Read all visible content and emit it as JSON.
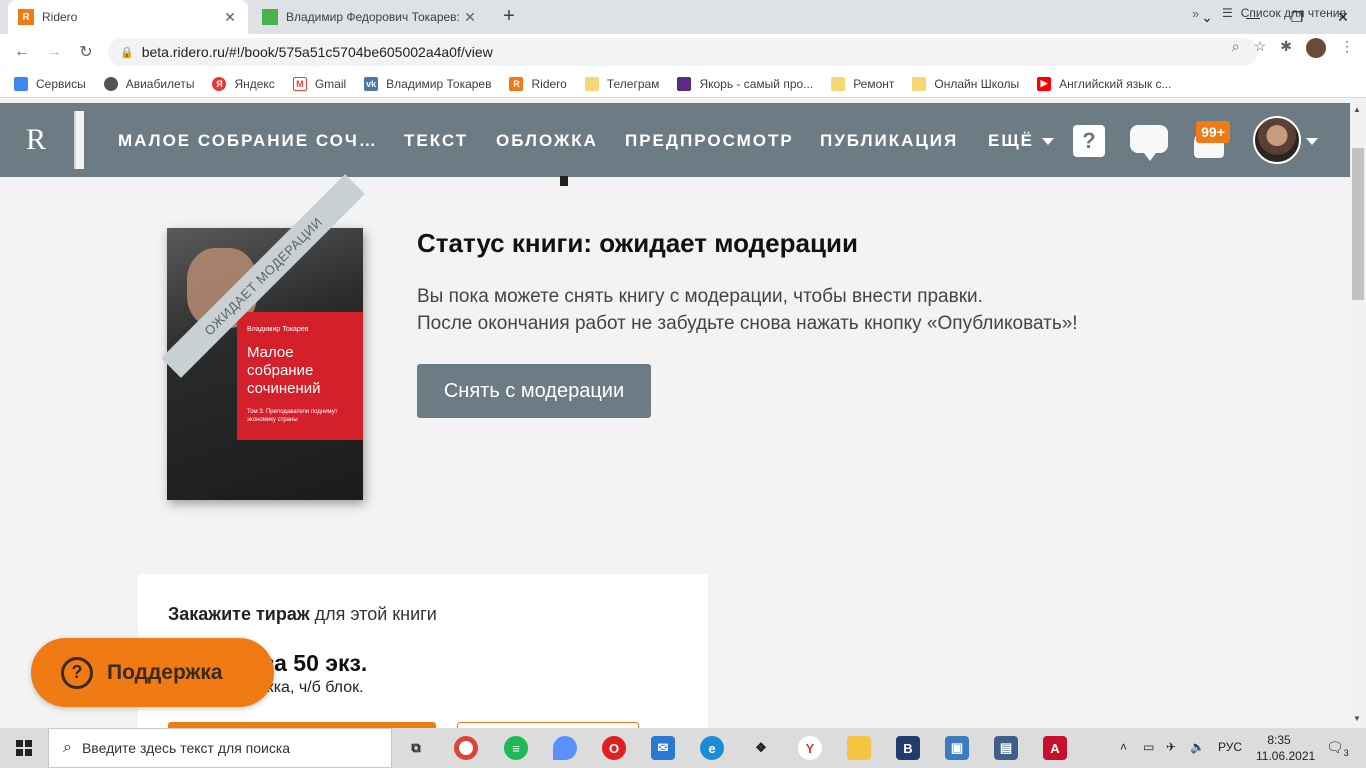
{
  "browser": {
    "tabs": [
      {
        "title": "Ridero",
        "favicon": "R",
        "color": "#f07a14"
      },
      {
        "title": "Владимир Федорович Токарев:",
        "favicon": "",
        "color": "#4caf50"
      }
    ],
    "address": "beta.ridero.ru/#!/book/575a51c5704be605002a4a0f/view",
    "bookmarks": [
      {
        "label": "Сервисы",
        "icon": "apps-icon",
        "color": "#4285f4"
      },
      {
        "label": "Авиабилеты",
        "icon": "globe-icon",
        "color": "#555555"
      },
      {
        "label": "Яндекс",
        "icon": "yandex-icon",
        "color": "#e53935"
      },
      {
        "label": "Gmail",
        "icon": "gmail-icon",
        "color": "#ea4335"
      },
      {
        "label": "Владимир Токарев",
        "icon": "vk-icon",
        "color": "#4a76a8"
      },
      {
        "label": "Ridero",
        "icon": "ridero-icon",
        "color": "#f07a14"
      },
      {
        "label": "Телеграм",
        "icon": "folder-icon",
        "color": "#f7d774"
      },
      {
        "label": "Якорь - самый про...",
        "icon": "yakor-icon",
        "color": "#5b2c83"
      },
      {
        "label": "Ремонт",
        "icon": "folder-icon",
        "color": "#f7d774"
      },
      {
        "label": "Онлайн Школы",
        "icon": "folder-icon",
        "color": "#f7d774"
      },
      {
        "label": "Английский язык с...",
        "icon": "youtube-icon",
        "color": "#ff0000"
      }
    ],
    "more": "»",
    "reading_list": "Список для чтения"
  },
  "header": {
    "logo": "R",
    "nav": [
      {
        "label": "МАЛОЕ СОБРАНИЕ СОЧ…"
      },
      {
        "label": "ТЕКСТ"
      },
      {
        "label": "ОБЛОЖКА"
      },
      {
        "label": "ПРЕДПРОСМОТР"
      },
      {
        "label": "ПУБЛИКАЦИЯ"
      },
      {
        "label": "ЕЩЁ"
      }
    ],
    "help": "?",
    "notifications_badge": "99+"
  },
  "book": {
    "author": "Владимир Токарев",
    "title": "Малое собрание сочинений",
    "subtitle": "Том 3. Преподаватели поднимут экономику страны",
    "ribbon": "ОЖИДАЕТ МОДЕРАЦИИ"
  },
  "status": {
    "title": "Статус книги: ожидает модерации",
    "line1": "Вы пока можете снять книгу с модерации, чтобы внести правки.",
    "line2": "После окончания работ не забудьте снова нажать кнопку «Опубликовать»!",
    "button": "Снять с модерации"
  },
  "print": {
    "headline_bold": "Закажите тираж",
    "headline_rest": " для этой книги",
    "price": "за 50 экз.",
    "desc": "жка, ч/б блок."
  },
  "support": {
    "label": "Поддержка"
  },
  "taskbar": {
    "search_placeholder": "Введите здесь текст для поиска",
    "lang": "РУС",
    "time": "8:35",
    "date": "11.06.2021",
    "notif_count": "3"
  }
}
